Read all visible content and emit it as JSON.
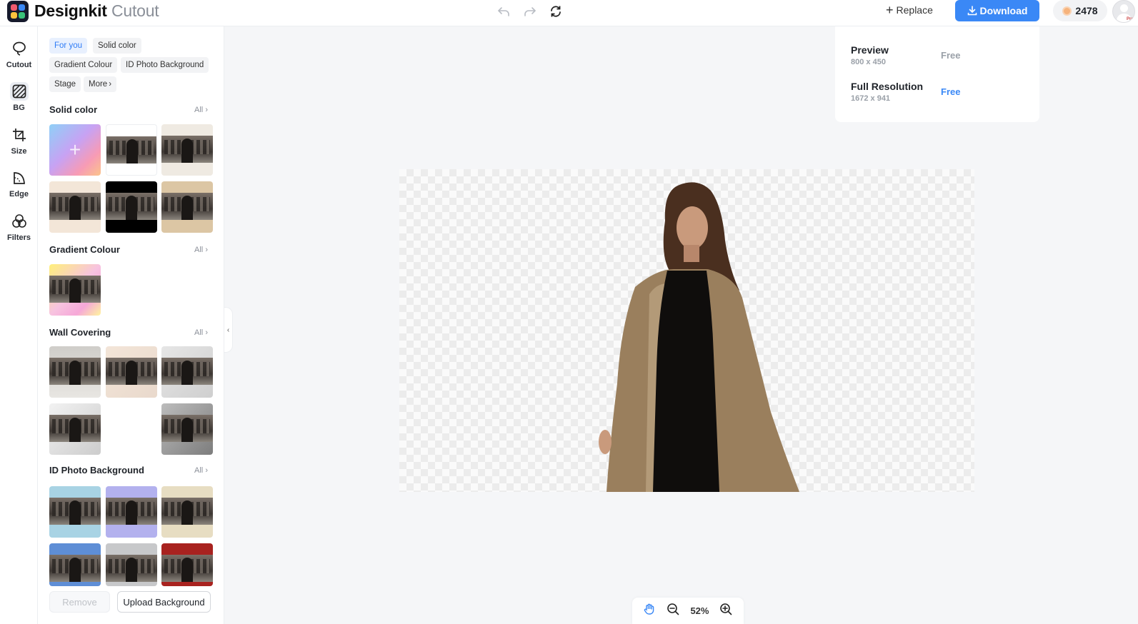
{
  "header": {
    "brand_name": "Designkit",
    "brand_sub": "Cutout",
    "replace_label": "Replace",
    "download_label": "Download",
    "credits": "2478",
    "avatar_badge": "Pro"
  },
  "rail": {
    "items": [
      {
        "label": "Cutout",
        "icon": "lasso-icon"
      },
      {
        "label": "BG",
        "icon": "background-icon"
      },
      {
        "label": "Size",
        "icon": "crop-icon"
      },
      {
        "label": "Edge",
        "icon": "edge-icon"
      },
      {
        "label": "Filters",
        "icon": "filters-icon"
      }
    ]
  },
  "panel": {
    "chips": [
      "For you",
      "Solid color",
      "Gradient Colour",
      "ID Photo Background",
      "Stage",
      "More"
    ],
    "sections": [
      {
        "title": "Solid color",
        "all": "All"
      },
      {
        "title": "Gradient Colour",
        "all": "All"
      },
      {
        "title": "Wall Covering",
        "all": "All"
      },
      {
        "title": "ID Photo Background",
        "all": "All"
      }
    ],
    "remove_label": "Remove",
    "upload_label": "Upload Background"
  },
  "download_menu": {
    "options": [
      {
        "name": "Preview",
        "size": "800 x 450",
        "price": "Free",
        "price_color": "#9aa0a8"
      },
      {
        "name": "Full Resolution",
        "size": "1672 x 941",
        "price": "Free",
        "price_color": "#3a88f6"
      }
    ]
  },
  "zoom": {
    "value": "52%"
  },
  "colors": {
    "accent": "#3a88f6"
  }
}
